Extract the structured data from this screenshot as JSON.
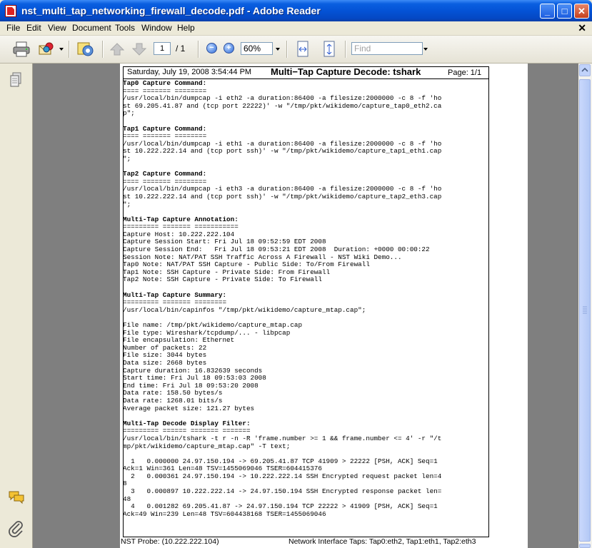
{
  "window": {
    "title": "nst_multi_tap_networking_firewall_decode.pdf - Adobe Reader",
    "minimize_label": "_",
    "maximize_label": "□",
    "close_label": "✕"
  },
  "menu": {
    "items": [
      "File",
      "Edit",
      "View",
      "Document",
      "Tools",
      "Window",
      "Help"
    ],
    "close_doc_label": "✕"
  },
  "toolbar": {
    "page_current": "1",
    "page_total": "/ 1",
    "zoom_value": "60%",
    "find_placeholder": "Find"
  },
  "document": {
    "header_date": "Saturday, July 19, 2008 3:54:44 PM",
    "header_title": "Multi−Tap Capture Decode: tshark",
    "header_page": "Page: 1/1",
    "lines": [
      "Tap0 Capture Command:",
      "==== ======= ========",
      "/usr/local/bin/dumpcap -i eth2 -a duration:86400 -a filesize:2000000 -c 8 -f 'ho",
      "st 69.205.41.87 and (tcp port 22222)' -w \"/tmp/pkt/wikidemo/capture_tap0_eth2.ca",
      "p\";",
      "",
      "Tap1 Capture Command:",
      "==== ======= ========",
      "/usr/local/bin/dumpcap -i eth1 -a duration:86400 -a filesize:2000000 -c 8 -f 'ho",
      "st 10.222.222.14 and (tcp port ssh)' -w \"/tmp/pkt/wikidemo/capture_tap1_eth1.cap",
      "\";",
      "",
      "Tap2 Capture Command:",
      "==== ======= ========",
      "/usr/local/bin/dumpcap -i eth3 -a duration:86400 -a filesize:2000000 -c 8 -f 'ho",
      "st 10.222.222.14 and (tcp port ssh)' -w \"/tmp/pkt/wikidemo/capture_tap2_eth3.cap",
      "\";",
      "",
      "Multi-Tap Capture Annotation:",
      "========= ======= ===========",
      "Capture Host: 10.222.222.104",
      "Capture Session Start: Fri Jul 18 09:52:59 EDT 2008",
      "Capture Session End:   Fri Jul 18 09:53:21 EDT 2008  Duration: +0000 00:00:22",
      "Session Note: NAT/PAT SSH Traffic Across A Firewall - NST Wiki Demo...",
      "Tap0 Note: NAT/PAT SSH Capture - Public Side: To/From Firewall",
      "Tap1 Note: SSH Capture - Private Side: From Firewall",
      "Tap2 Note: SSH Capture - Private Side: To Firewall",
      "",
      "Multi-Tap Capture Summary:",
      "========= ======= ========",
      "/usr/local/bin/capinfos \"/tmp/pkt/wikidemo/capture_mtap.cap\";",
      "",
      "File name: /tmp/pkt/wikidemo/capture_mtap.cap",
      "File type: Wireshark/tcpdump/... - libpcap",
      "File encapsulation: Ethernet",
      "Number of packets: 22",
      "File size: 3044 bytes",
      "Data size: 2668 bytes",
      "Capture duration: 16.832639 seconds",
      "Start time: Fri Jul 18 09:53:03 2008",
      "End time: Fri Jul 18 09:53:20 2008",
      "Data rate: 158.50 bytes/s",
      "Data rate: 1268.01 bits/s",
      "Average packet size: 121.27 bytes",
      "",
      "Multi-Tap Decode Display Filter:",
      "========= ====== ======= =======",
      "/usr/local/bin/tshark -t r -n -R 'frame.number >= 1 && frame.number <= 4' -r \"/t",
      "mp/pkt/wikidemo/capture_mtap.cap\" -T text;",
      "",
      "  1   0.000000 24.97.150.194 -> 69.205.41.87 TCP 41909 > 22222 [PSH, ACK] Seq=1",
      "Ack=1 Win=361 Len=48 TSV=1455069046 TSER=604415376",
      "  2   0.000361 24.97.150.194 -> 10.222.222.14 SSH Encrypted request packet len=4",
      "8",
      "  3   0.000897 10.222.222.14 -> 24.97.150.194 SSH Encrypted response packet len=",
      "48",
      "  4   0.001282 69.205.41.87 -> 24.97.150.194 TCP 22222 > 41909 [PSH, ACK] Seq=1",
      "Ack=49 Win=239 Len=48 TSV=604438168 TSER=1455069046"
    ],
    "footer_left": "NST Probe: (10.222.222.104)",
    "footer_right": "Network Interface Taps: Tap0:eth2, Tap1:eth1, Tap2:eth3"
  },
  "icons": {
    "app": "pdf-document-icon",
    "print": "printer-icon",
    "email": "email-icon",
    "organizer": "organizer-icon",
    "prev": "previous-page-icon",
    "next": "next-page-icon",
    "zoom_out": "zoom-out-icon",
    "zoom_in": "zoom-in-icon",
    "fit_width": "fit-width-icon",
    "fit_page": "fit-page-icon",
    "pages_panel": "pages-icon",
    "comments": "comments-icon",
    "attachments": "paperclip-icon"
  }
}
